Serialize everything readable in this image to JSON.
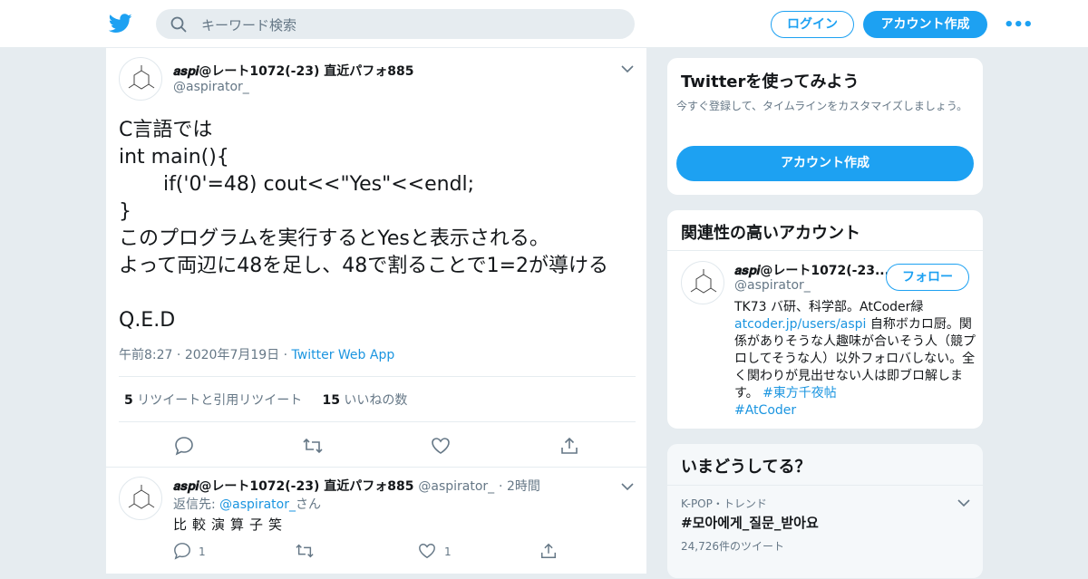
{
  "header": {
    "search_placeholder": "キーワード検索",
    "login_label": "ログイン",
    "signup_label": "アカウント作成",
    "more_label": "•••"
  },
  "tweet": {
    "author_name": "𝒂𝒔𝒑𝒊@レート1072(-23) 直近パフォ885",
    "author_handle": "@aspirator_",
    "lines": [
      "C言語では",
      "int main(){",
      "       if('0'=48) cout<<\"Yes\"<<endl;",
      "}",
      "このプログラムを実行するとYesと表示される。",
      "よって両辺に48を足し、48で割ることで1=2が導ける",
      "",
      "Q.E.D"
    ],
    "time": "午前8:27",
    "date": "2020年7月19日",
    "source": "Twitter Web App",
    "retweet_count": "5",
    "retweet_label": "リツイートと引用リツイート",
    "like_count": "15",
    "like_label": "いいねの数"
  },
  "reply": {
    "author_name": "𝒂𝒔𝒑𝒊@レート1072(-23) 直近パフォ885",
    "author_handle": "@aspirator_",
    "time": "2時間",
    "reply_prefix": "返信先: ",
    "reply_to": "@aspirator_",
    "reply_suffix": "さん",
    "text": "比較演算子笑",
    "reply_count": "1",
    "like_count": "1"
  },
  "signup_card": {
    "title": "Twitterを使ってみよう",
    "subtitle": "今すぐ登録して、タイムラインをカスタマイズしましょう。",
    "button": "アカウント作成"
  },
  "related_card": {
    "title": "関連性の高いアカウント",
    "name": "𝒂𝒔𝒑𝒊@レート1072(-23...",
    "handle": "@aspirator_",
    "follow": "フォロー",
    "bio_1": "TK73 バ研、科学部。AtCoder緑",
    "bio_link": "atcoder.jp/users/aspi",
    "bio_2": " 自称ボカロ厨。関係がありそうな人趣味が合いそう人（競プロしてそうな人）以外フォロバしない。全く関わりが見出せない人は即ブロ解します。 ",
    "bio_tag1": "#東方千夜帖",
    "bio_tag2": "#AtCoder"
  },
  "trends": {
    "title": "いまどうしてる？",
    "category": "K-POP・トレンド",
    "name": "#모아에게_질문_받아요",
    "count": "24,726件のツイート"
  },
  "colors": {
    "accent": "#1da1f2",
    "link": "#1b95e0",
    "muted": "#657786",
    "bg": "#e6ecf0"
  }
}
